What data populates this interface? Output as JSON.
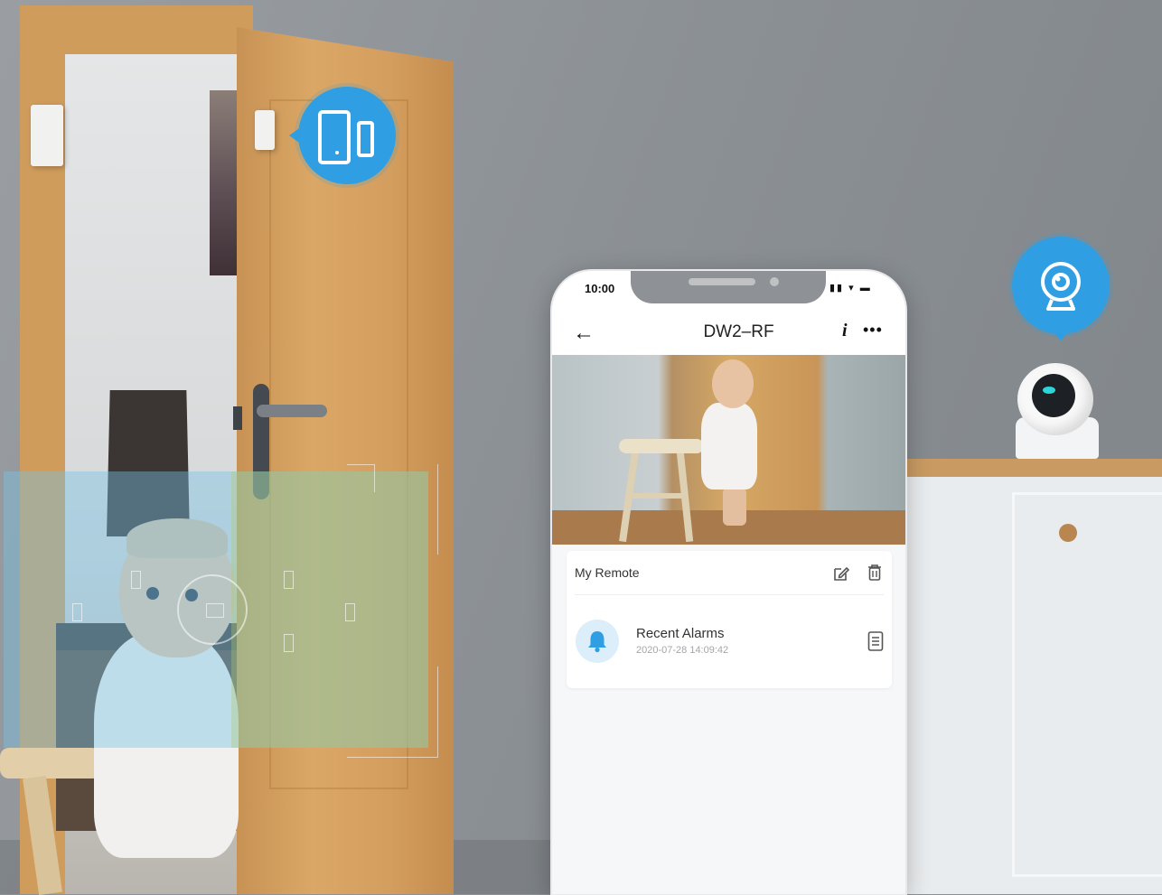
{
  "phone": {
    "status": {
      "time": "10:00",
      "signal_icons": "▮▮ ▾ ▬"
    },
    "nav": {
      "back_label": "←",
      "title": "DW2–RF",
      "info_label": "i",
      "more_label": "•••"
    },
    "card": {
      "title": "My Remote",
      "edit_icon": "edit-icon",
      "delete_icon": "trash-icon",
      "alarm": {
        "title": "Recent Alarms",
        "timestamp": "2020-07-28 14:09:42",
        "icon": "bell-icon",
        "action_icon": "document-icon"
      }
    }
  },
  "callouts": {
    "door_sensor_icon": "door-sensor-icon",
    "camera_icon": "webcam-icon"
  },
  "colors": {
    "accent": "#2f9ee2",
    "bell_bg": "#dbeefa",
    "overlay_blue": "#78c3e6"
  }
}
